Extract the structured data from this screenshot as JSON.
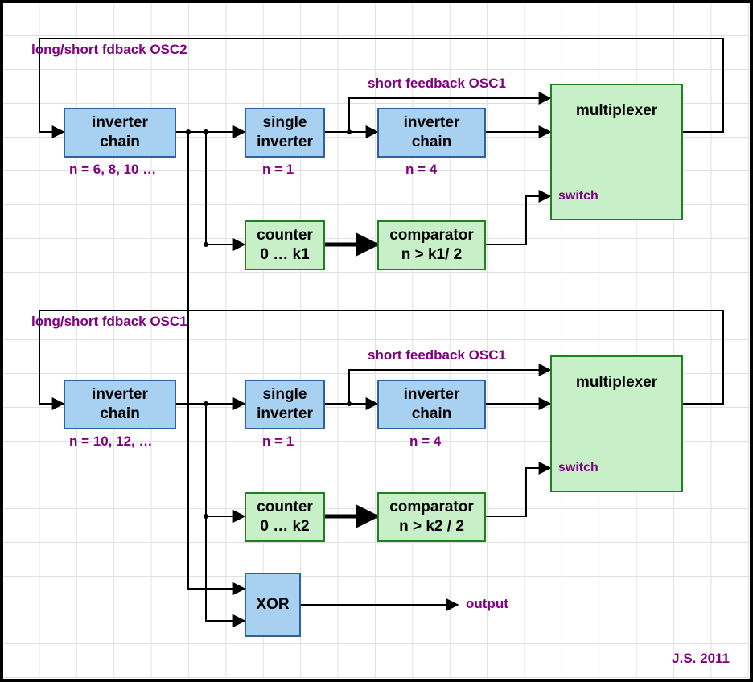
{
  "labels": {
    "fdback_osc2": "long/short fdback OSC2",
    "fdback_osc1": "long/short fdback OSC1",
    "short_fb_1": "short feedback OSC1",
    "short_fb_2": "short feedback OSC1",
    "output": "output",
    "credit": "J.S. 2011"
  },
  "osc1": {
    "inv_chain_a": {
      "line1": "inverter",
      "line2": "chain",
      "sub": "n =  6, 8, 10 …"
    },
    "single_inv": {
      "line1": "single",
      "line2": "inverter",
      "sub": "n = 1"
    },
    "inv_chain_b": {
      "line1": "inverter",
      "line2": "chain",
      "sub": "n =  4"
    },
    "counter": {
      "line1": "counter",
      "line2": "0 … k1"
    },
    "comparator": {
      "line1": "comparator",
      "line2": "n > k1/ 2"
    },
    "mux": {
      "title": "multiplexer",
      "switch": "switch"
    }
  },
  "osc2": {
    "inv_chain_a": {
      "line1": "inverter",
      "line2": "chain",
      "sub": "n =  10, 12, …"
    },
    "single_inv": {
      "line1": "single",
      "line2": "inverter",
      "sub": "n = 1"
    },
    "inv_chain_b": {
      "line1": "inverter",
      "line2": "chain",
      "sub": "n = 4"
    },
    "counter": {
      "line1": "counter",
      "line2": "0 … k2"
    },
    "comparator": {
      "line1": "comparator",
      "line2": "n > k2 / 2"
    },
    "mux": {
      "title": "multiplexer",
      "switch": "switch"
    }
  },
  "xor": {
    "label": "XOR"
  }
}
